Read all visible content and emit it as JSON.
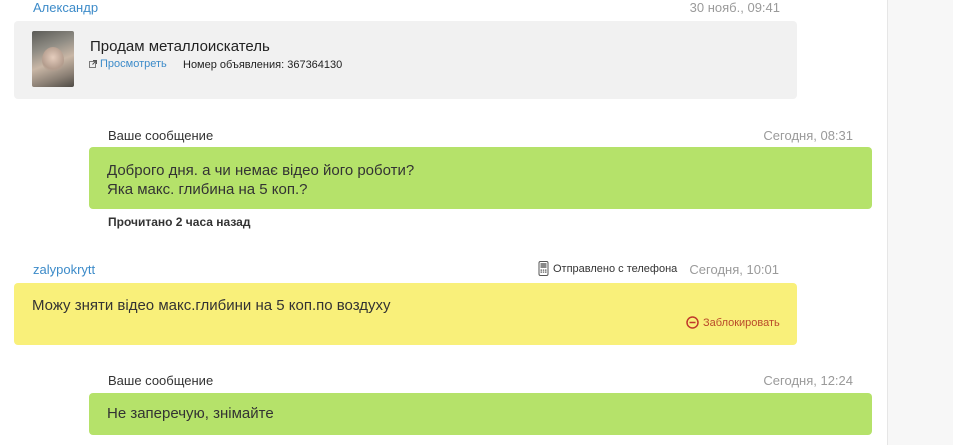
{
  "conversation": {
    "ad": {
      "sender": "Александр",
      "time": "30 нояб., 09:41",
      "title": "Продам металлоискатель",
      "view_label": "Просмотреть",
      "ad_number_label": "Номер объявления: 367364130"
    },
    "messages": [
      {
        "author": "Ваше сообщение",
        "time": "Сегодня, 08:31",
        "lines": [
          "Доброго дня. а чи немає відео його роботи?",
          "Яка макс. глибина на 5 коп.?"
        ],
        "read_status": "Прочитано 2 часа назад"
      },
      {
        "author": "zalypokrytt",
        "sent_from": "Отправлено с телефона",
        "time": "Сегодня, 10:01",
        "lines": [
          "Можу зняти відео макс.глибини на 5 коп.по воздуху"
        ],
        "block_label": "Заблокировать"
      },
      {
        "author": "Ваше сообщение",
        "time": "Сегодня, 12:24",
        "lines": [
          "Не заперечую, знімайте"
        ]
      }
    ]
  },
  "icons": {
    "external": "external-link-icon",
    "phone": "mobile-phone-icon",
    "block": "block-icon"
  },
  "colors": {
    "own_bubble": "#b5e26a",
    "other_bubble": "#f9f07a",
    "ad_card": "#f1f1f1",
    "link": "#3c8bc9",
    "block": "#b94a2a"
  }
}
